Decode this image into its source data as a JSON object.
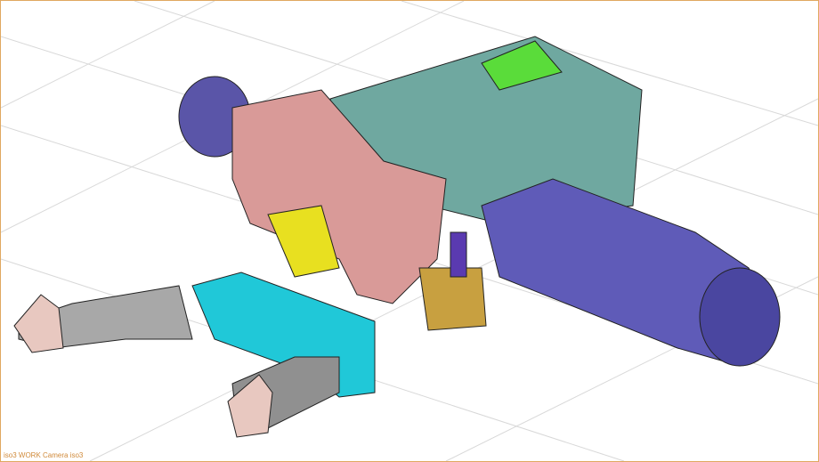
{
  "viewport": {
    "status_text": "iso3 WORK Camera iso3",
    "colors": {
      "border": "#e0a860",
      "status": "#d08a3a",
      "grid": "#d8d8d8"
    }
  }
}
